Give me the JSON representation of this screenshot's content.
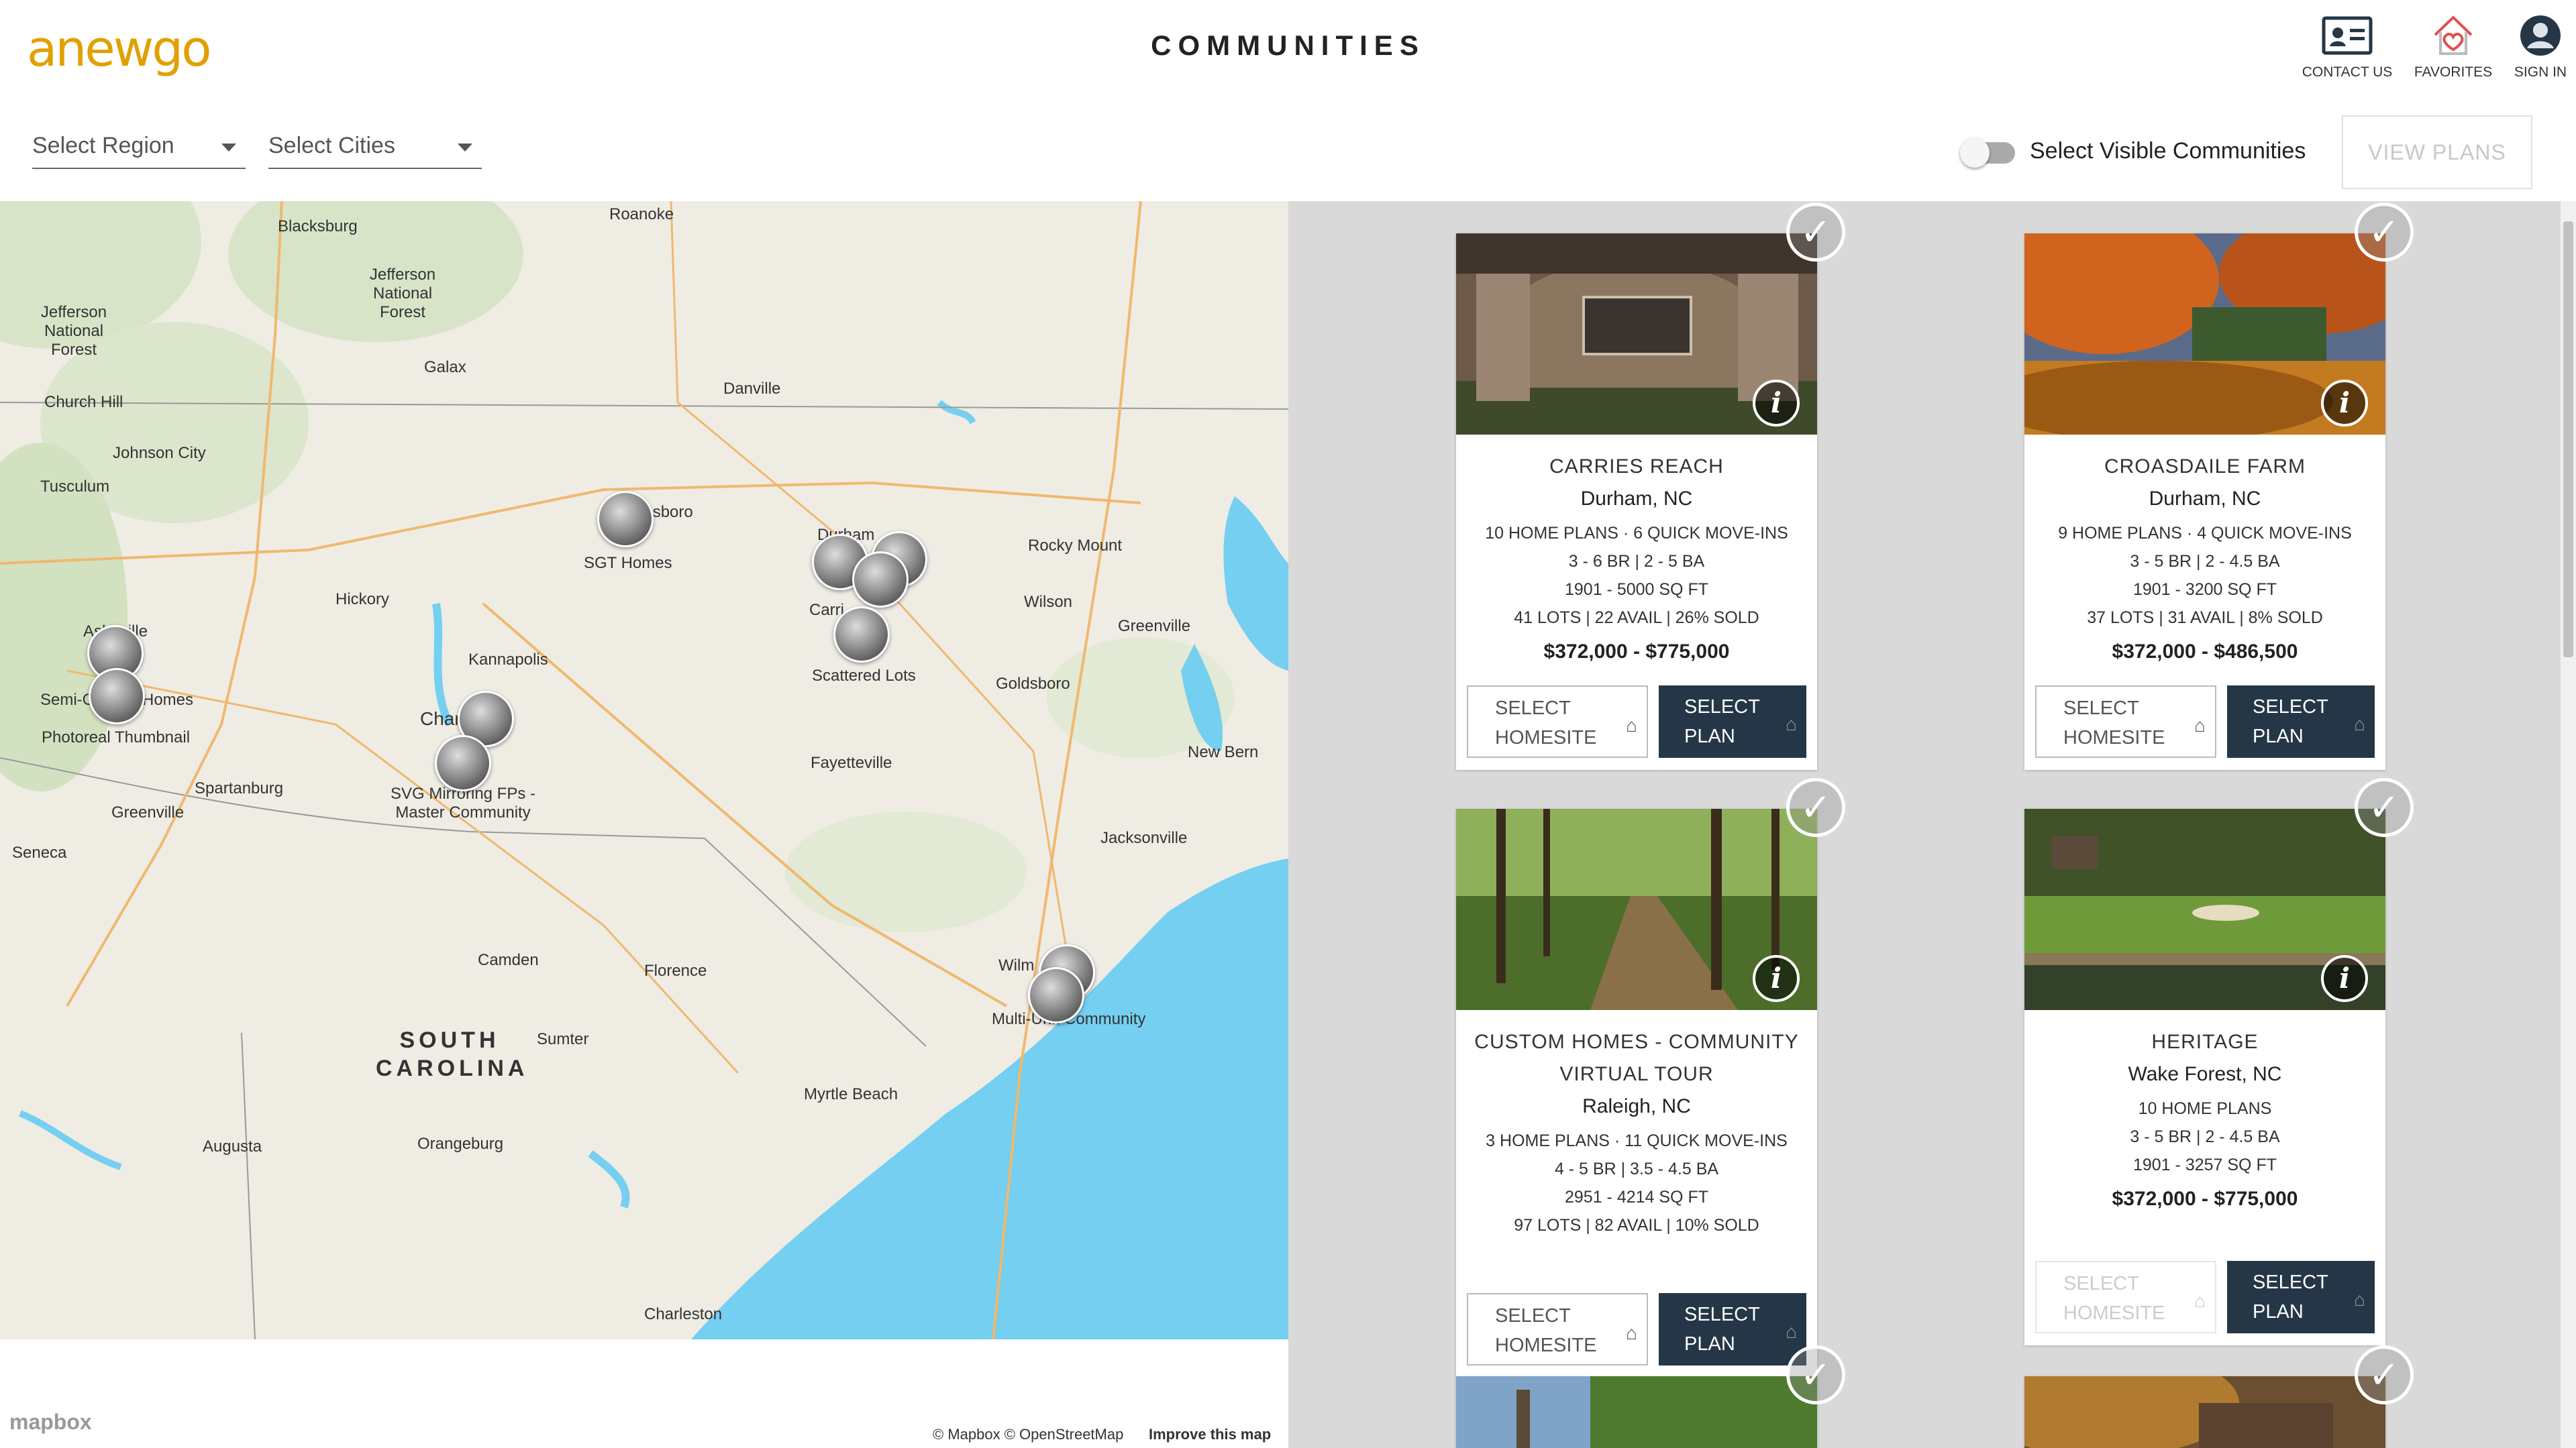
{
  "app": {
    "logo_text": "anewgo",
    "title": "COMMUNITIES"
  },
  "header": {
    "contact": "CONTACT US",
    "favorites": "FAVORITES",
    "signin": "SIGN IN"
  },
  "filters": {
    "region": "Select Region",
    "cities": "Select Cities",
    "toggle_label": "Select Visible Communities",
    "view_plans": "VIEW PLANS"
  },
  "map": {
    "labels": [
      "Blacksburg",
      "Roanoke",
      "Jefferson National Forest",
      "Jefferson National Forest",
      "Galax",
      "Danville",
      "Church Hill",
      "Johnson City",
      "Tusculum",
      "Durham",
      "ensboro",
      "SGT Homes",
      "Rocky Mount",
      "Hickory",
      "Wilson",
      "Greenville",
      "Kannapolis",
      "Carri",
      "Scattered Lots",
      "Goldsboro",
      "Photoreal Thumbnail",
      "Semi-C",
      "Homes",
      "Asheville",
      "Char",
      "Fayetteville",
      "New Bern",
      "Spartanburg",
      "SVG Mirroring FPs - Master Community",
      "Greenville",
      "Jacksonville",
      "Seneca",
      "Camden",
      "Florence",
      "Wilm",
      "Multi-Unit Community",
      "Sumter",
      "Myrtle Beach",
      "Augusta",
      "Orangeburg",
      "Charleston"
    ],
    "state": "SOUTH CAROLINA",
    "attribution": "© Mapbox © OpenStreetMap",
    "improve": "Improve this map",
    "mapbox": "mapbox"
  },
  "cards": [
    {
      "name": "CARRIES REACH",
      "city": "Durham, NC",
      "plans": "10 HOME PLANS · 6 QUICK MOVE-INS",
      "beds": "3 - 6 BR  |  2 - 5 BA",
      "sqft": "1901 - 5000 SQ FT",
      "lots": "41 LOTS | 22 AVAIL | 26% SOLD",
      "price": "$372,000 - $775,000",
      "homesite_label": "SELECT HOMESITE",
      "plan_label": "SELECT PLAN",
      "homesite_enabled": true
    },
    {
      "name": "CROASDAILE FARM",
      "city": "Durham, NC",
      "plans": "9 HOME PLANS · 4 QUICK MOVE-INS",
      "beds": "3 - 5 BR  |  2 - 4.5 BA",
      "sqft": "1901 - 3200 SQ FT",
      "lots": "37 LOTS | 31 AVAIL | 8% SOLD",
      "price": "$372,000 - $486,500",
      "homesite_label": "SELECT HOMESITE",
      "plan_label": "SELECT PLAN",
      "homesite_enabled": true
    },
    {
      "name": "CUSTOM HOMES - COMMUNITY VIRTUAL TOUR",
      "city": "Raleigh, NC",
      "plans": "3 HOME PLANS · 11 QUICK MOVE-INS",
      "beds": "4 - 5 BR  |  3.5 - 4.5 BA",
      "sqft": "2951 - 4214 SQ FT",
      "lots": "97 LOTS | 82 AVAIL | 10% SOLD",
      "price": "",
      "homesite_label": "SELECT HOMESITE",
      "plan_label": "SELECT PLAN",
      "homesite_enabled": true
    },
    {
      "name": "HERITAGE",
      "city": "Wake Forest, NC",
      "plans": "10 HOME PLANS",
      "beds": "3 - 5 BR  |  2 - 4.5 BA",
      "sqft": "1901 - 3257 SQ FT",
      "lots": "",
      "price": "$372,000 - $775,000",
      "homesite_label": "SELECT HOMESITE",
      "plan_label": "SELECT PLAN",
      "homesite_enabled": false
    }
  ],
  "colors": {
    "accent": "#253746",
    "logo": "#f2b705",
    "water": "#75cff0",
    "favorite": "#e05050"
  }
}
